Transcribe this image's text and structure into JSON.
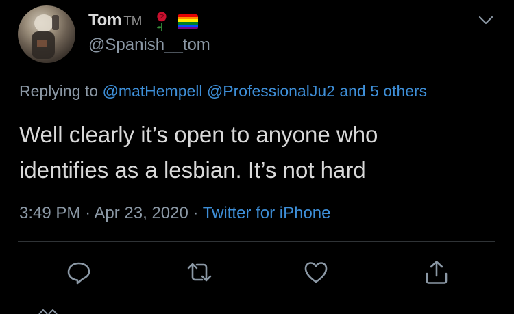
{
  "tweet": {
    "author": {
      "display_name": "Tom",
      "display_name_suffix": "TM",
      "handle": "@Spanish__tom",
      "avatar_icon": "avatar-photo",
      "badges": [
        "rose-icon",
        "rainbow-flag-icon"
      ]
    },
    "menu_icon": "chevron-down-icon",
    "reply_context": {
      "prefix": "Replying to",
      "mentions": [
        "@matHempell",
        "@ProfessionalJu2"
      ],
      "joiner": "and",
      "others": "5 others"
    },
    "text": "Well clearly it’s open to anyone who\nidentifies as a lesbian. It’s not hard",
    "timestamp": {
      "time": "3:49 PM",
      "separator": "·",
      "date": "Apr 23, 2020",
      "source": "Twitter for iPhone"
    },
    "actions": [
      "reply-icon",
      "retweet-icon",
      "like-icon",
      "share-icon"
    ]
  },
  "colors": {
    "background": "#000000",
    "text": "#d9d9d9",
    "muted": "#8b98a5",
    "link": "#3e8fd8",
    "divider": "#2f3336",
    "rose": "#c8102e"
  }
}
